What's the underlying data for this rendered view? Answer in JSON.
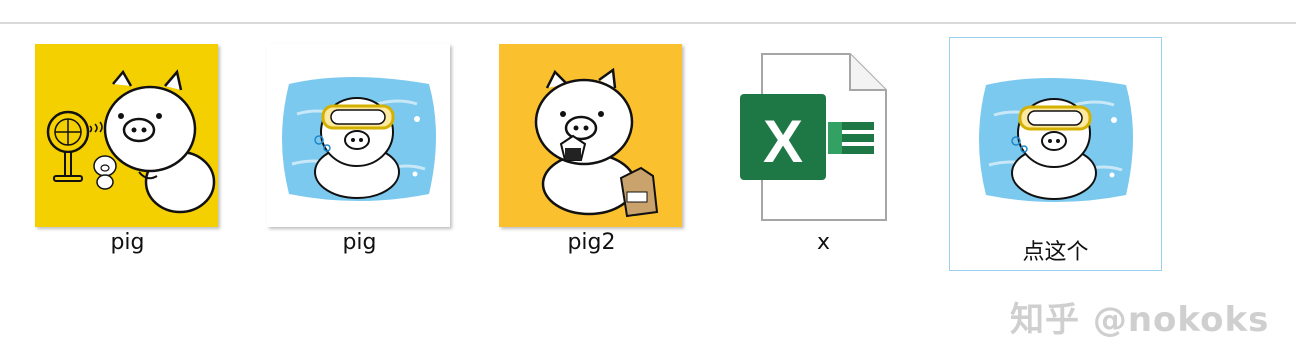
{
  "files": [
    {
      "name": "pig",
      "type": "image"
    },
    {
      "name": "pig",
      "type": "image"
    },
    {
      "name": "pig2",
      "type": "image"
    },
    {
      "name": "x",
      "type": "excel-workbook"
    },
    {
      "name": "点这个",
      "type": "image",
      "selected": true
    }
  ],
  "excel_badge_letter": "X",
  "watermark": "知乎 @nokoks",
  "colors": {
    "selection_border": "#99d1ef",
    "thumb1_bg": "#f5d000",
    "thumb3_bg": "#fbc02d",
    "water": "#7cc9ef",
    "excel_green": "#1d7845"
  }
}
